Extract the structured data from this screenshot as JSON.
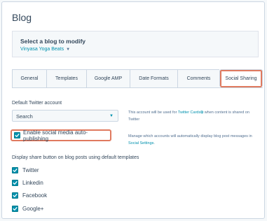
{
  "page": {
    "title": "Blog"
  },
  "blog_selector": {
    "label": "Select a blog to modify",
    "selected_blog": "Vinyasa Yoga Beats"
  },
  "tabs": [
    {
      "label": "General",
      "active": false
    },
    {
      "label": "Templates",
      "active": false
    },
    {
      "label": "Google AMP",
      "active": false
    },
    {
      "label": "Date Formats",
      "active": false
    },
    {
      "label": "Comments",
      "active": false
    },
    {
      "label": "Social Sharing",
      "active": true
    }
  ],
  "twitter": {
    "label": "Default Twitter account",
    "dropdown_value": "Search",
    "help_prefix": "This account will be used for ",
    "help_link": "Twitter Cards",
    "help_suffix": " when content is shared on Twitter"
  },
  "auto_publishing": {
    "label": "Enable social media auto-publishing",
    "checked": true,
    "help_prefix": "Manage which accounts will automatically display blog post messages in ",
    "help_link": "Social Settings",
    "help_suffix": "."
  },
  "share_buttons": {
    "label": "Display share button on blog posts using default templates",
    "items": [
      {
        "label": "Twitter",
        "checked": true
      },
      {
        "label": "Linkedin",
        "checked": true
      },
      {
        "label": "Facebook",
        "checked": true
      },
      {
        "label": "Google+",
        "checked": true
      }
    ]
  },
  "colors": {
    "accent": "#0091ae",
    "highlight": "#e07a5f",
    "text": "#33475b"
  }
}
